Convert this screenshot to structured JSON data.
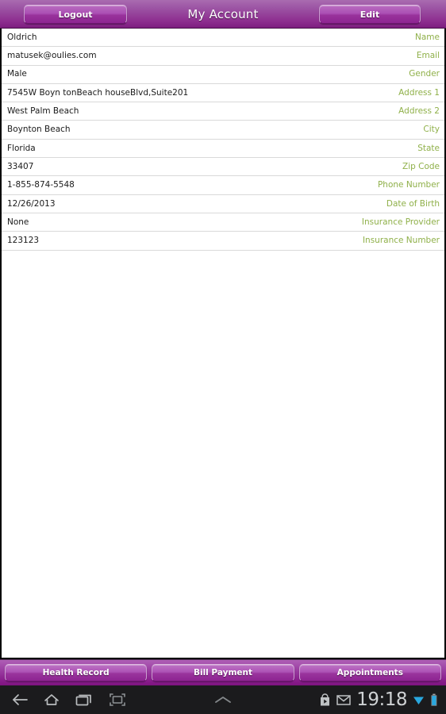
{
  "titlebar": {
    "logout_label": "Logout",
    "title": "My Account",
    "edit_label": "Edit"
  },
  "account": {
    "rows": [
      {
        "value": "Oldrich",
        "label": "Name"
      },
      {
        "value": "matusek@oulies.com",
        "label": "Email"
      },
      {
        "value": "Male",
        "label": "Gender"
      },
      {
        "value": "7545W Boyn tonBeach houseBlvd,Suite201",
        "label": "Address 1"
      },
      {
        "value": "West Palm Beach",
        "label": "Address 2"
      },
      {
        "value": "Boynton Beach",
        "label": "City"
      },
      {
        "value": "Florida",
        "label": "State"
      },
      {
        "value": "33407",
        "label": "Zip Code"
      },
      {
        "value": "1-855-874-5548",
        "label": "Phone Number"
      },
      {
        "value": "12/26/2013",
        "label": "Date of Birth"
      },
      {
        "value": "None",
        "label": "Insurance Provider"
      },
      {
        "value": "123123",
        "label": "Insurance Number"
      }
    ]
  },
  "tabbar": {
    "items": [
      {
        "label": "Health Record"
      },
      {
        "label": "Bill Payment"
      },
      {
        "label": "Appointments"
      }
    ]
  },
  "systembar": {
    "back_icon": "back-arrow-icon",
    "home_icon": "home-icon",
    "recents_icon": "recent-apps-icon",
    "screenshot_icon": "screenshot-icon",
    "expand_icon": "chevron-up-icon",
    "playstore_icon": "play-store-icon",
    "mail_icon": "gmail-envelope-icon",
    "clock": "19:18",
    "wifi_icon": "wifi-icon",
    "battery_icon": "battery-icon"
  },
  "colors": {
    "accent_purple": "#9c3fa3",
    "label_green": "#8fb049",
    "value_text": "#1a1a1a",
    "content_bg": "#ffffff",
    "sysbar_bg": "#1b1b1d"
  }
}
